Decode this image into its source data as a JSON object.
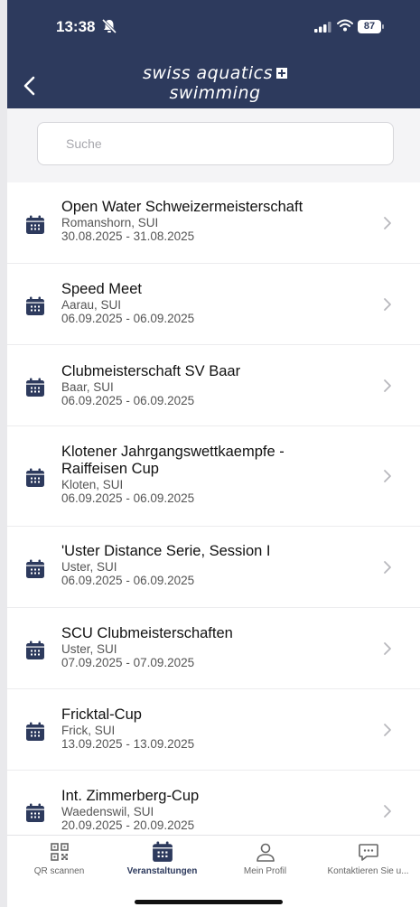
{
  "status": {
    "time": "13:38",
    "battery": "87"
  },
  "header": {
    "brand_line1": "swiss aquatics",
    "brand_line2": "swimming"
  },
  "search": {
    "placeholder": "Suche"
  },
  "events": [
    {
      "title": "Open Water Schweizermeisterschaft",
      "location": "Romanshorn, SUI",
      "dates": "30.08.2025 - 31.08.2025"
    },
    {
      "title": "Speed Meet",
      "location": "Aarau, SUI",
      "dates": "06.09.2025 - 06.09.2025"
    },
    {
      "title": "Clubmeisterschaft SV Baar",
      "location": "Baar, SUI",
      "dates": "06.09.2025 - 06.09.2025"
    },
    {
      "title": "Klotener Jahrgangswettkaempfe - Raiffeisen Cup",
      "location": "Kloten, SUI",
      "dates": "06.09.2025 - 06.09.2025"
    },
    {
      "title": "'Uster Distance Serie, Session I",
      "location": "Uster, SUI",
      "dates": "06.09.2025 - 06.09.2025"
    },
    {
      "title": "SCU Clubmeisterschaften",
      "location": "Uster, SUI",
      "dates": "07.09.2025 - 07.09.2025"
    },
    {
      "title": "Fricktal-Cup",
      "location": "Frick, SUI",
      "dates": "13.09.2025 - 13.09.2025"
    },
    {
      "title": "Int. Zimmerberg-Cup",
      "location": "Waedenswil, SUI",
      "dates": "20.09.2025 - 20.09.2025"
    }
  ],
  "tabs": [
    {
      "label": "QR scannen",
      "icon": "qr-code-icon"
    },
    {
      "label": "Veranstaltungen",
      "icon": "calendar-icon",
      "active": true
    },
    {
      "label": "Mein Profil",
      "icon": "person-icon"
    },
    {
      "label": "Kontaktieren Sie u...",
      "icon": "chat-icon"
    }
  ],
  "colors": {
    "header": "#2d3a5d",
    "accent": "#2d3a5d"
  }
}
